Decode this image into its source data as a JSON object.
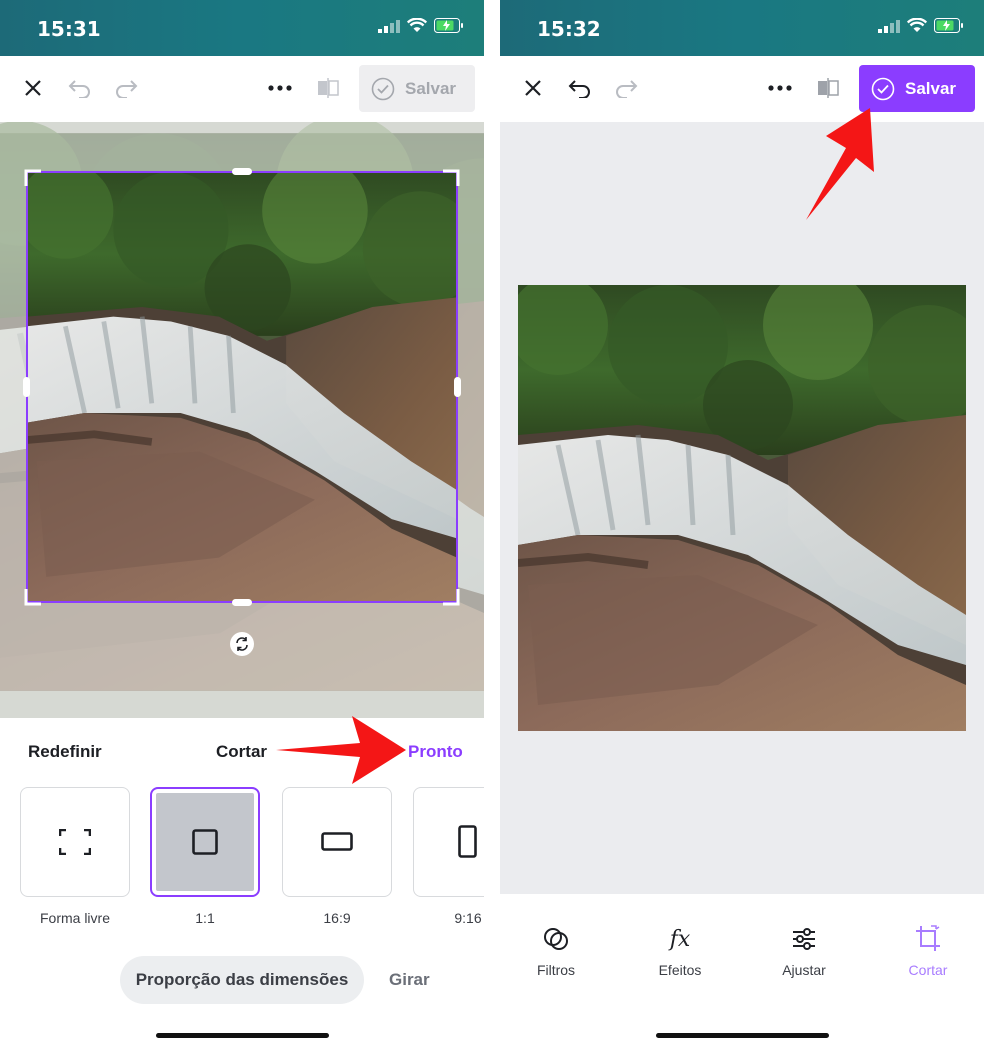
{
  "left": {
    "status": {
      "time": "15:31"
    },
    "toolbar": {
      "save_label": "Salvar"
    },
    "sheet": {
      "reset": "Redefinir",
      "title": "Cortar",
      "done": "Pronto",
      "ratios": [
        {
          "label": "Forma livre",
          "icon": "freeform-icon"
        },
        {
          "label": "1:1",
          "icon": "square-ratio-icon",
          "selected": true
        },
        {
          "label": "16:9",
          "icon": "landscape-ratio-icon"
        },
        {
          "label": "9:16",
          "icon": "portrait-ratio-icon"
        }
      ],
      "aspect_tab": "Proporção das dimensões",
      "rotate_tab": "Girar"
    }
  },
  "right": {
    "status": {
      "time": "15:32"
    },
    "toolbar": {
      "save_label": "Salvar"
    },
    "tabs": [
      {
        "label": "Filtros",
        "icon": "filters-icon"
      },
      {
        "label": "Efeitos",
        "icon": "effects-icon"
      },
      {
        "label": "Ajustar",
        "icon": "adjust-icon"
      },
      {
        "label": "Cortar",
        "icon": "crop-icon",
        "active": true
      }
    ]
  },
  "colors": {
    "accent": "#8b3dff",
    "annotation_arrow": "#f41616",
    "status_bar": "#1a7882"
  }
}
